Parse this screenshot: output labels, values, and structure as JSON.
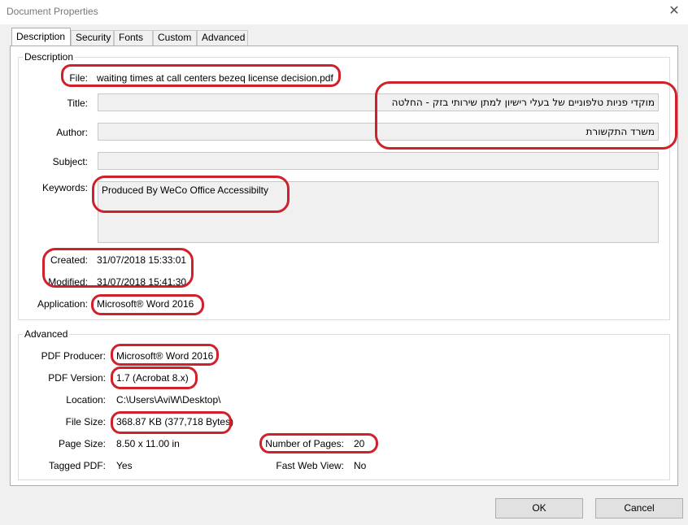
{
  "window": {
    "title": "Document Properties",
    "close_glyph": "✕"
  },
  "tabs": [
    "Description",
    "Security",
    "Fonts",
    "Custom",
    "Advanced"
  ],
  "description": {
    "group_title": "Description",
    "file_label": "File:",
    "file_value": "waiting times at call centers bezeq license decision.pdf",
    "title_label": "Title:",
    "title_value": "מוקדי פניות טלפוניים של בעלי רישיון למתן שירותי בזק - החלטה",
    "author_label": "Author:",
    "author_value": "משרד התקשורת",
    "subject_label": "Subject:",
    "subject_value": "",
    "keywords_label": "Keywords:",
    "keywords_value": "Produced By WeCo Office Accessibilty",
    "created_label": "Created:",
    "created_value": "31/07/2018 15:33:01",
    "modified_label": "Modified:",
    "modified_value": "31/07/2018 15:41:30",
    "application_label": "Application:",
    "application_value": "Microsoft® Word 2016"
  },
  "advanced": {
    "group_title": "Advanced",
    "pdf_producer_label": "PDF Producer:",
    "pdf_producer_value": "Microsoft® Word 2016",
    "pdf_version_label": "PDF Version:",
    "pdf_version_value": "1.7 (Acrobat 8.x)",
    "location_label": "Location:",
    "location_value": "C:\\Users\\AviW\\Desktop\\",
    "file_size_label": "File Size:",
    "file_size_value": "368.87 KB (377,718 Bytes)",
    "page_size_label": "Page Size:",
    "page_size_value": "8.50 x 11.00 in",
    "num_pages_label": "Number of Pages:",
    "num_pages_value": "20",
    "tagged_pdf_label": "Tagged PDF:",
    "tagged_pdf_value": "Yes",
    "fast_web_view_label": "Fast Web View:",
    "fast_web_view_value": "No"
  },
  "buttons": {
    "ok": "OK",
    "cancel": "Cancel"
  },
  "colors": {
    "annotation": "#d0202a",
    "field_bg": "#f0f0f0"
  }
}
